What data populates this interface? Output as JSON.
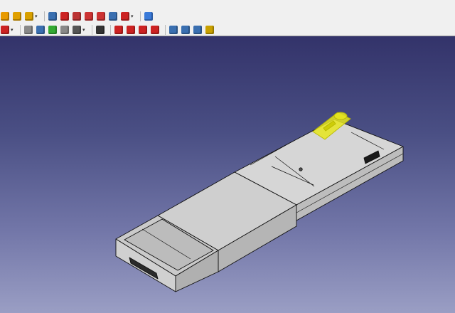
{
  "toolbar": {
    "row1": [
      {
        "icon": "sketch-icon",
        "color": "#e89a00"
      },
      {
        "icon": "attachment-icon",
        "color": "#e0a000"
      },
      {
        "icon": "part-box-icon",
        "color": "#d8a000",
        "dropdown": true
      },
      {
        "sep": true
      },
      {
        "icon": "boolean-icon",
        "color": "#3a6fb0"
      },
      {
        "icon": "cut-icon",
        "color": "#c22"
      },
      {
        "icon": "fuse-icon",
        "color": "#b33"
      },
      {
        "icon": "common-icon",
        "color": "#c33"
      },
      {
        "icon": "section-icon",
        "color": "#c33"
      },
      {
        "icon": "extrude-icon",
        "color": "#3a6fb0"
      },
      {
        "icon": "revolve-icon",
        "color": "#c22",
        "dropdown": true
      },
      {
        "sep": true
      },
      {
        "icon": "chamfer-icon",
        "color": "#3a7ad8"
      }
    ],
    "row2": [
      {
        "icon": "view-icon",
        "color": "#c22",
        "dropdown": true
      },
      {
        "sep": true
      },
      {
        "icon": "axonometric-icon",
        "color": "#888"
      },
      {
        "icon": "person-icon",
        "color": "#3a6fb0"
      },
      {
        "icon": "fit-all-icon",
        "color": "#3a3"
      },
      {
        "icon": "draw-style-icon",
        "color": "#888"
      },
      {
        "icon": "bounding-box-icon",
        "color": "#555",
        "dropdown": true
      },
      {
        "sep": true
      },
      {
        "icon": "whats-this-icon",
        "color": "#333"
      },
      {
        "sep": true
      },
      {
        "icon": "view-front-icon",
        "color": "#c22"
      },
      {
        "icon": "view-top-icon",
        "color": "#c22"
      },
      {
        "icon": "view-right-icon",
        "color": "#c22"
      },
      {
        "icon": "view-rear-icon",
        "color": "#c22"
      },
      {
        "sep": true
      },
      {
        "icon": "measure-icon",
        "color": "#3a6fb0"
      },
      {
        "icon": "measure-linear-icon",
        "color": "#3a6fb0"
      },
      {
        "icon": "measure-angular-icon",
        "color": "#3a6fb0"
      },
      {
        "icon": "measure-clear-icon",
        "color": "#c9a000"
      }
    ]
  },
  "viewport": {
    "background_top": "#33336a",
    "background_bottom": "#9a9ec4",
    "model_face_color": "#d2d2d2",
    "model_edge_color": "#111111",
    "selection_color": "#e6e61e"
  }
}
